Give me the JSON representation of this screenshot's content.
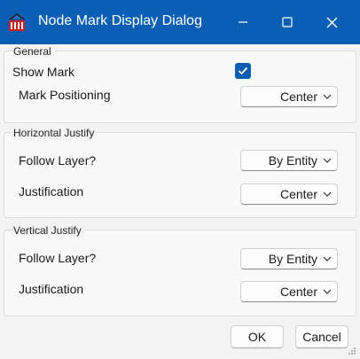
{
  "window": {
    "title": "Node Mark Display Dialog",
    "app_icon": "app-logo-icon",
    "controls": [
      "minimize-icon",
      "maximize-icon",
      "close-icon"
    ],
    "title_bar_color": "#0a5fb4"
  },
  "general": {
    "title": "General",
    "show_mark_label": "Show Mark",
    "show_mark_checked": true,
    "mark_positioning_label": "Mark Positioning",
    "mark_positioning_value": "Center"
  },
  "horizontal": {
    "title": "Horizontal Justify",
    "follow_layer_label": "Follow Layer?",
    "follow_layer_value": "By Entity",
    "justification_label": "Justification",
    "justification_value": "Center"
  },
  "vertical": {
    "title": "Vertical Justify",
    "follow_layer_label": "Follow Layer?",
    "follow_layer_value": "By Entity",
    "justification_label": "Justification",
    "justification_value": "Center"
  },
  "footer": {
    "ok_label": "OK",
    "cancel_label": "Cancel"
  },
  "colors": {
    "accent": "#0a5fb4"
  }
}
